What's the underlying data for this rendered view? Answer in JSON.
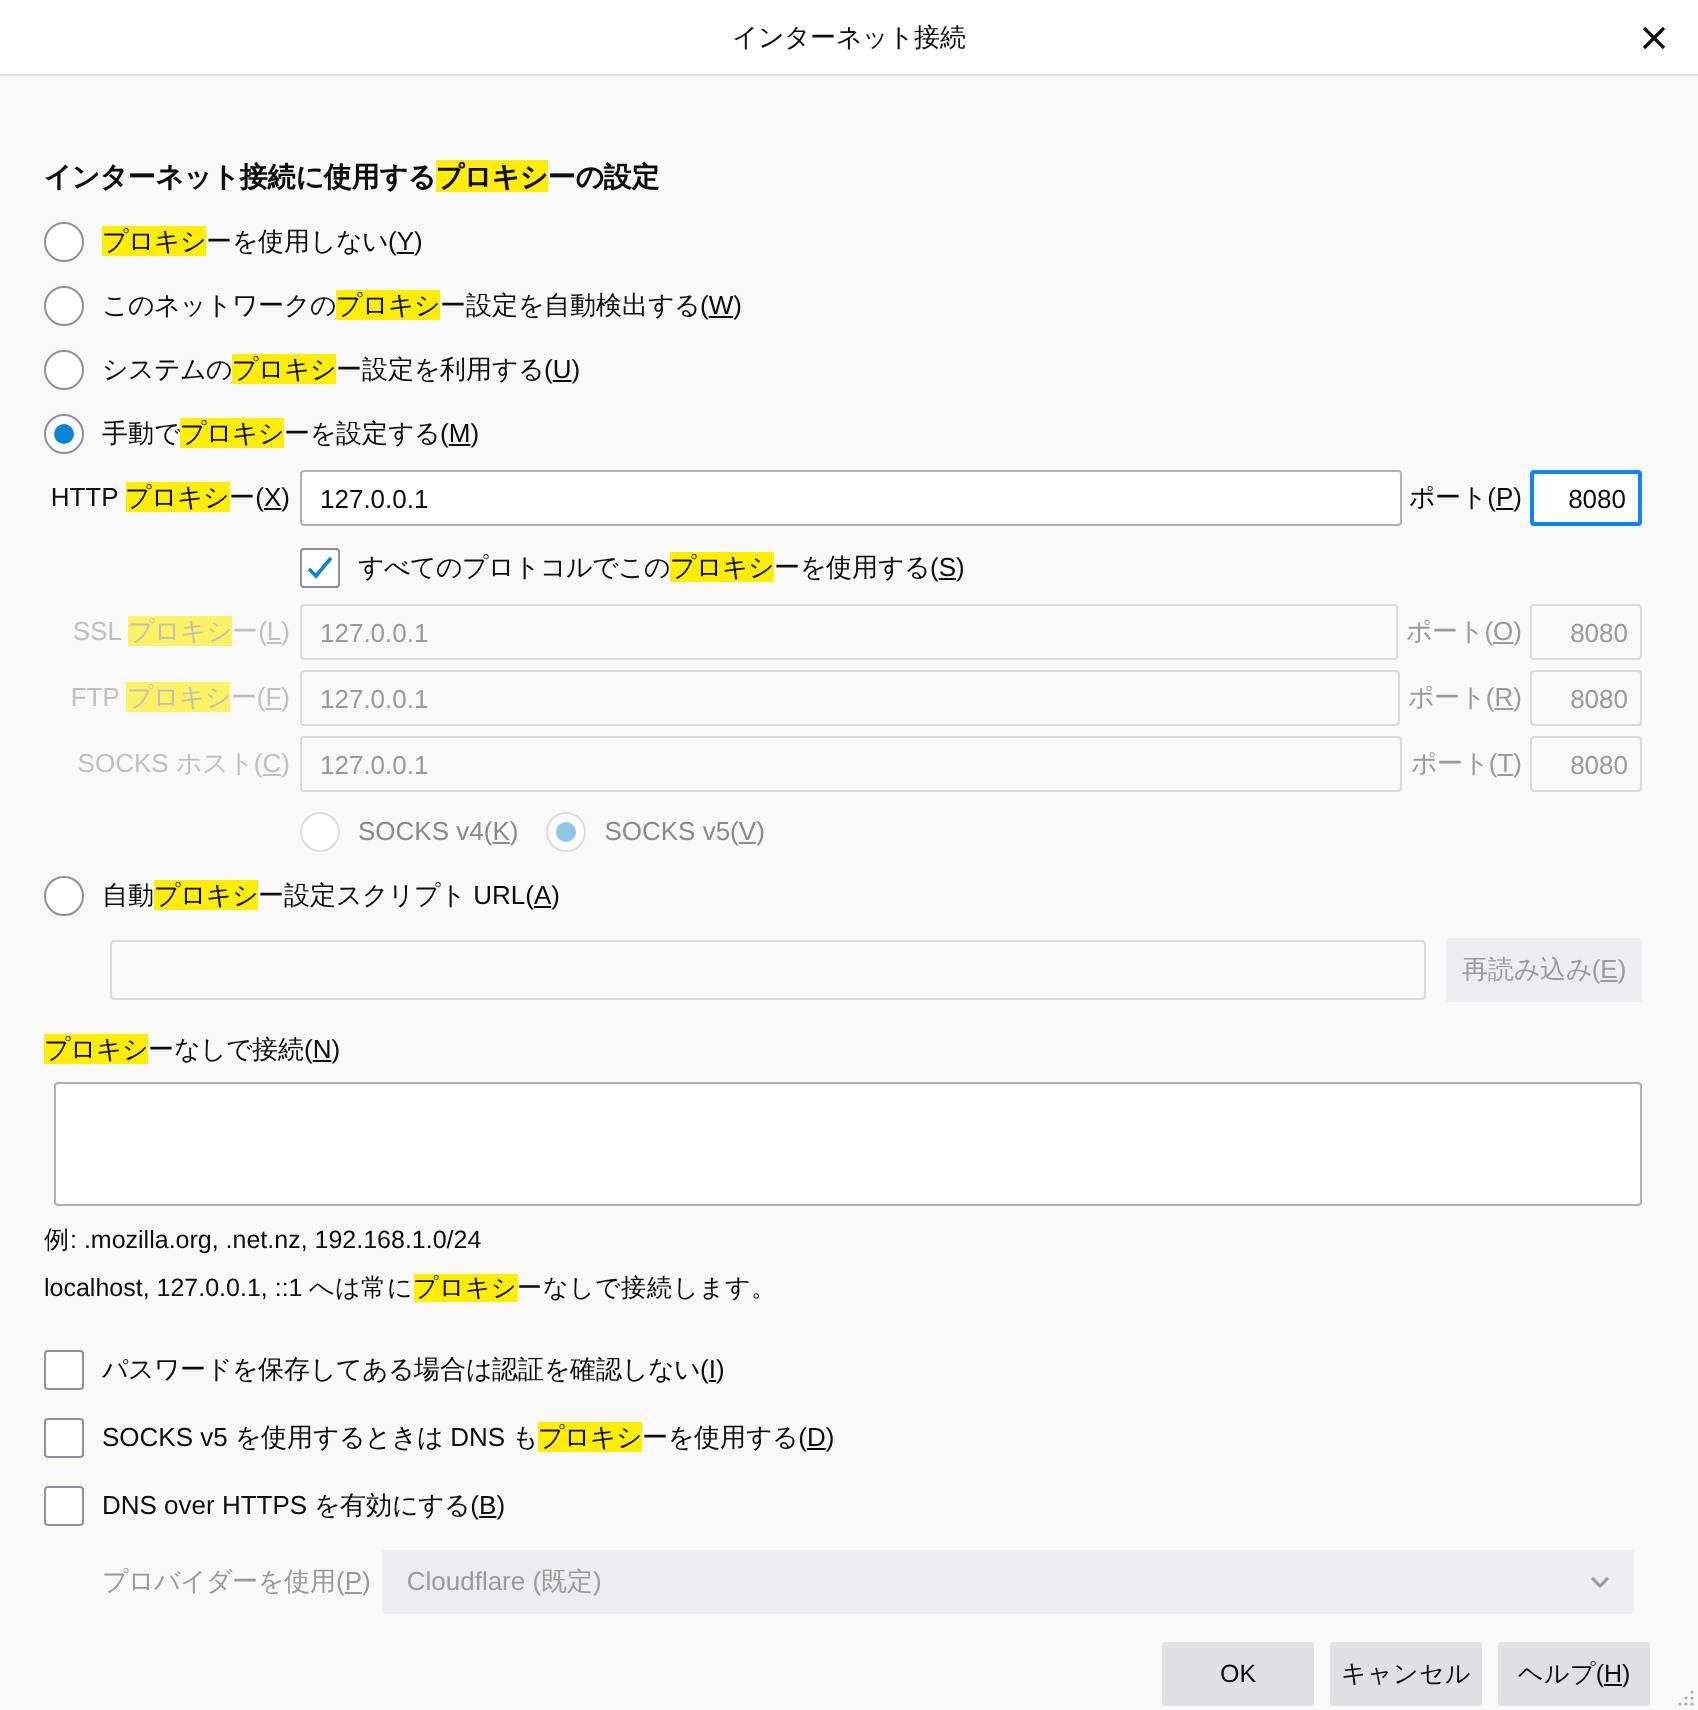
{
  "window": {
    "title": "インターネット接続"
  },
  "heading": [
    "インターネット接続に使用する",
    {
      "text": "プロキシ",
      "kind": "highlight"
    },
    "ーの設定"
  ],
  "proxy_modes": [
    {
      "label": [
        {
          "text": "プロキシ",
          "kind": "highlight"
        },
        "ーを使用しない(",
        {
          "text": "Y",
          "kind": "accesskey"
        },
        ")"
      ],
      "selected": false
    },
    {
      "label": [
        "このネットワークの",
        {
          "text": "プロキシ",
          "kind": "highlight"
        },
        "ー設定を自動検出する(",
        {
          "text": "W",
          "kind": "accesskey"
        },
        ")"
      ],
      "selected": false
    },
    {
      "label": [
        "システムの",
        {
          "text": "プロキシ",
          "kind": "highlight"
        },
        "ー設定を利用する(",
        {
          "text": "U",
          "kind": "accesskey"
        },
        ")"
      ],
      "selected": false
    },
    {
      "label": [
        "手動で",
        {
          "text": "プロキシ",
          "kind": "highlight"
        },
        "ーを設定する(",
        {
          "text": "M",
          "kind": "accesskey"
        },
        ")"
      ],
      "selected": true
    }
  ],
  "http": {
    "label": [
      "HTTP ",
      {
        "text": "プロキシ",
        "kind": "highlight"
      },
      "ー(",
      {
        "text": "X",
        "kind": "accesskey"
      },
      ")"
    ],
    "value": "127.0.0.1",
    "port_label": [
      "ポート(",
      {
        "text": "P",
        "kind": "accesskey"
      },
      ")"
    ],
    "port": "8080",
    "port_focused": true,
    "disabled": false
  },
  "share_all": {
    "label": [
      "すべてのプロトコルでこの",
      {
        "text": "プロキシ",
        "kind": "highlight"
      },
      "ーを使用する(",
      {
        "text": "S",
        "kind": "accesskey"
      },
      ")"
    ],
    "checked": true
  },
  "protocols": [
    {
      "label": [
        "SSL ",
        {
          "text": "プロキシ",
          "kind": "highlight"
        },
        "ー(",
        {
          "text": "L",
          "kind": "accesskey"
        },
        ")"
      ],
      "value": "127.0.0.1",
      "port_label": [
        "ポート(",
        {
          "text": "O",
          "kind": "accesskey"
        },
        ")"
      ],
      "port": "8080",
      "port_focused": false,
      "disabled": true
    },
    {
      "label": [
        "FTP ",
        {
          "text": "プロキシ",
          "kind": "highlight"
        },
        "ー(",
        {
          "text": "F",
          "kind": "accesskey"
        },
        ")"
      ],
      "value": "127.0.0.1",
      "port_label": [
        "ポート(",
        {
          "text": "R",
          "kind": "accesskey"
        },
        ")"
      ],
      "port": "8080",
      "port_focused": false,
      "disabled": true
    },
    {
      "label": [
        "SOCKS ホスト(",
        {
          "text": "C",
          "kind": "accesskey"
        },
        ")"
      ],
      "value": "127.0.0.1",
      "port_label": [
        "ポート(",
        {
          "text": "T",
          "kind": "accesskey"
        },
        ")"
      ],
      "port": "8080",
      "port_focused": false,
      "disabled": true
    }
  ],
  "socks_versions": [
    {
      "label": [
        "SOCKS v4(",
        {
          "text": "K",
          "kind": "accesskey"
        },
        ")"
      ],
      "selected": false,
      "disabled": true
    },
    {
      "label": [
        "SOCKS v5(",
        {
          "text": "V",
          "kind": "accesskey"
        },
        ")"
      ],
      "selected": true,
      "disabled": true
    }
  ],
  "auto_config": {
    "label": [
      "自動",
      {
        "text": "プロキシ",
        "kind": "highlight"
      },
      "ー設定スクリプト URL(",
      {
        "text": "A",
        "kind": "accesskey"
      },
      ")"
    ],
    "selected": false,
    "reload_button": [
      "再読み込み(",
      {
        "text": "E",
        "kind": "accesskey"
      },
      ")"
    ],
    "reload_disabled": true
  },
  "no_proxy": {
    "label": [
      {
        "text": "プロキシ",
        "kind": "highlight"
      },
      "ーなしで接続(",
      {
        "text": "N",
        "kind": "accesskey"
      },
      ")"
    ]
  },
  "example": [
    "例: .mozilla.org, .net.nz, 192.168.1.0/24"
  ],
  "note": [
    "localhost, 127.0.0.1, ::1 へは常に",
    {
      "text": "プロキシ",
      "kind": "highlight"
    },
    "ーなしで接続します。"
  ],
  "options": [
    {
      "label": [
        "パスワードを保存してある場合は認証を確認しない(",
        {
          "text": "I",
          "kind": "accesskey"
        },
        ")"
      ],
      "checked": false
    },
    {
      "label": [
        "SOCKS v5 を使用するときは DNS も",
        {
          "text": "プロキシ",
          "kind": "highlight"
        },
        "ーを使用する(",
        {
          "text": "D",
          "kind": "accesskey"
        },
        ")"
      ],
      "checked": false
    },
    {
      "label": [
        "DNS over HTTPS を有効にする(",
        {
          "text": "B",
          "kind": "accesskey"
        },
        ")"
      ],
      "checked": false
    }
  ],
  "provider": {
    "label": [
      "プロバイダーを使用(",
      {
        "text": "P",
        "kind": "accesskey"
      },
      ")"
    ],
    "value": "Cloudflare (既定)",
    "disabled": true
  },
  "buttons": [
    {
      "label": [
        "OK"
      ]
    },
    {
      "label": [
        "キャンセル"
      ]
    },
    {
      "label": [
        "ヘルプ(",
        {
          "text": "H",
          "kind": "accesskey"
        },
        ")"
      ]
    }
  ]
}
